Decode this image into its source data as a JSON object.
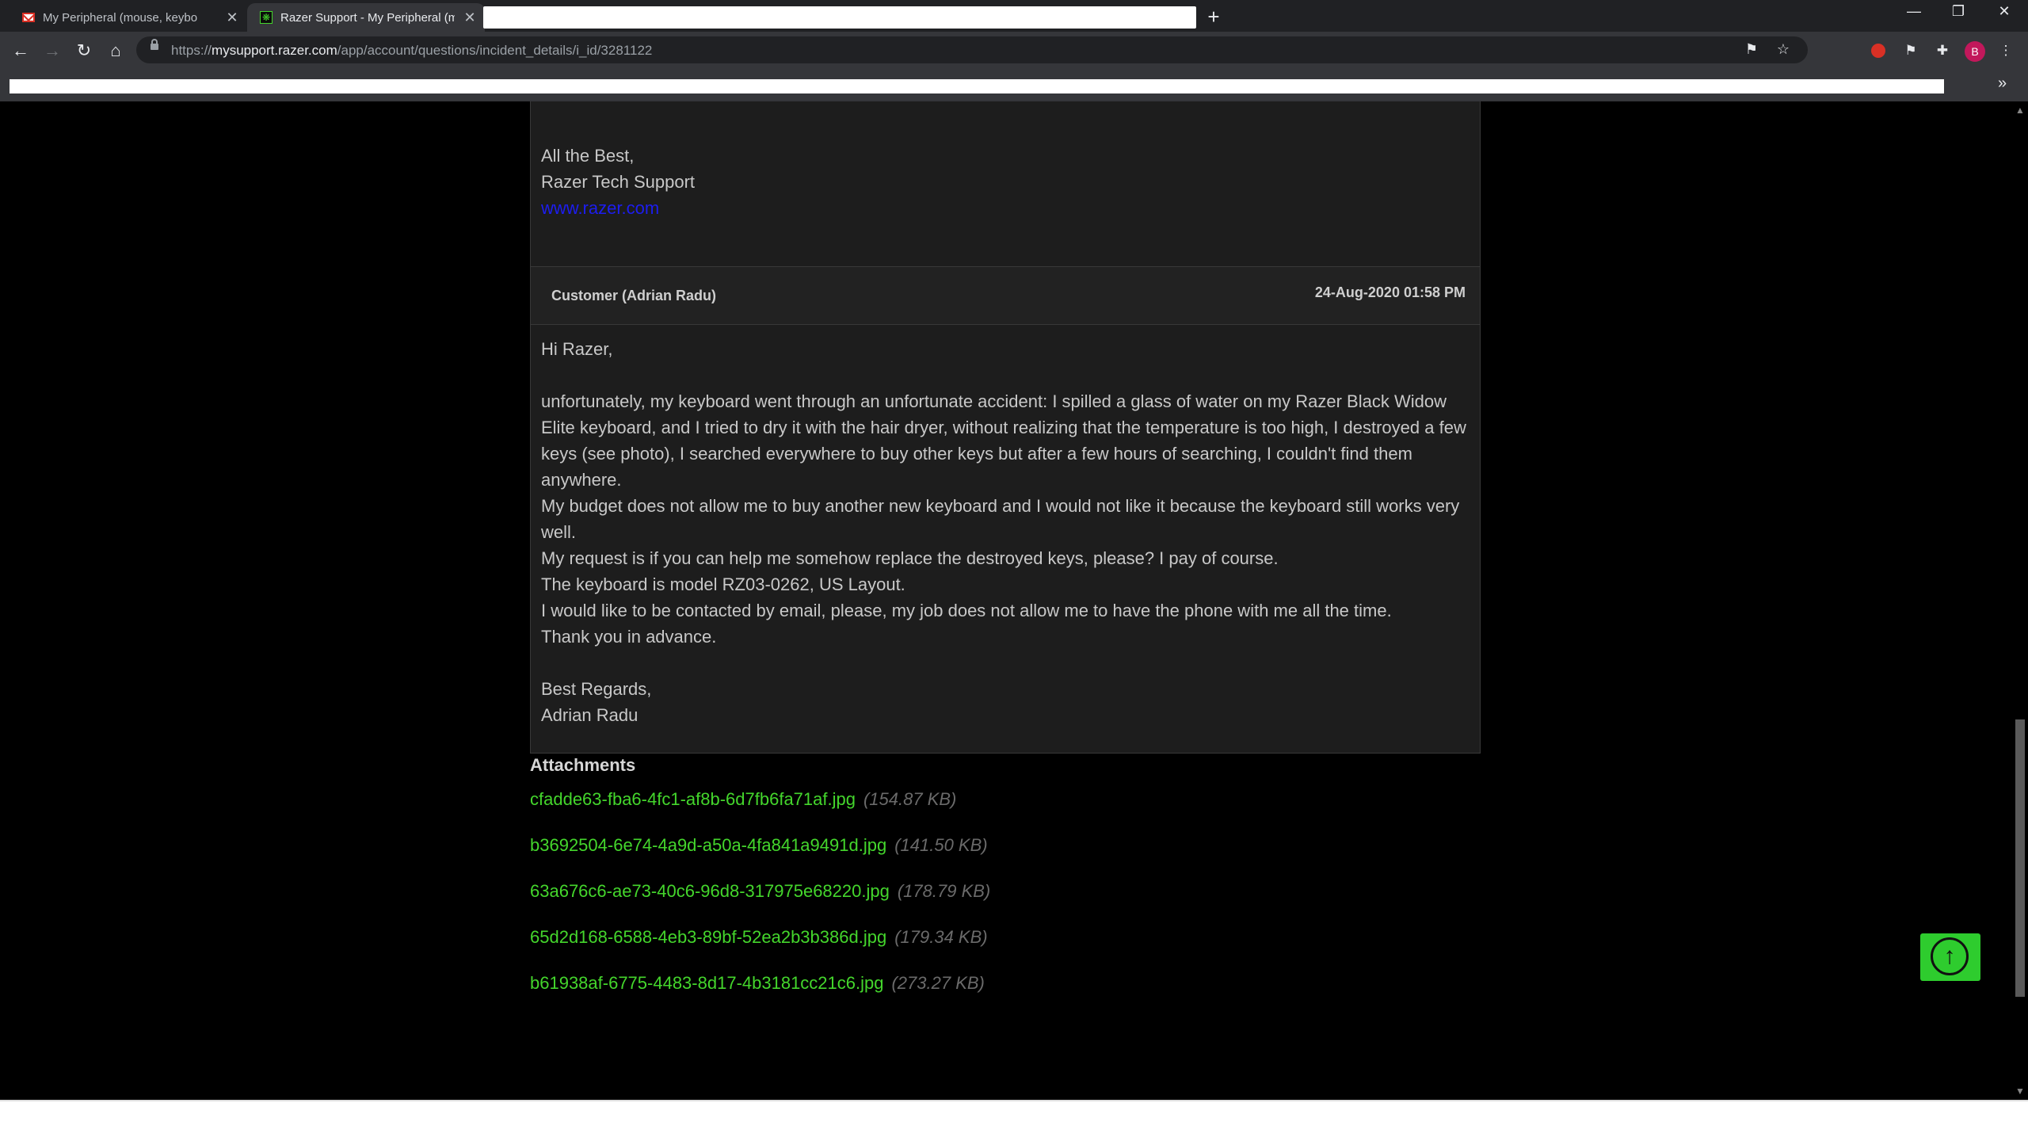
{
  "browser": {
    "tabs": [
      {
        "title": "My Peripheral (mouse, keybo",
        "close": "✕"
      },
      {
        "title": "Razer Support - My Peripheral (m",
        "close": "✕"
      }
    ],
    "new_tab": "+",
    "window": {
      "minimize": "—",
      "restore": "❐",
      "close": "✕"
    },
    "nav": {
      "back": "←",
      "forward": "→",
      "reload": "↻",
      "home": "⌂"
    },
    "url_host": "mysupport.razer.com",
    "url_prefix": "https://",
    "url_path": "/app/account/questions/incident_details/i_id/3281122",
    "profile_initial": "B",
    "bookmarks_more": "»"
  },
  "previous_message": {
    "lines": [
      "All the Best,",
      "Razer Tech Support"
    ],
    "link": "www.razer.com"
  },
  "entry": {
    "author": "Customer (Adrian Radu)",
    "date": "24-Aug-2020 01:58 PM",
    "greeting": "Hi Razer,",
    "paragraph1": "unfortunately, my keyboard went through an unfortunate accident: I spilled a glass of water on my Razer Black Widow Elite keyboard, and I tried to dry it with the hair dryer, without realizing that the temperature is too high, I destroyed a few keys (see photo), I searched everywhere to buy other keys but after a few hours of searching, I couldn't find them anywhere.",
    "paragraph2": "My budget does not allow me to buy another new keyboard and I would not like it because the keyboard still works very well.",
    "line3": "My request is if you can help me somehow replace the destroyed keys, please? I pay of course.",
    "line4": "The keyboard is model RZ03-0262, US Layout.",
    "line5": "I would like to be contacted by email, please, my job does not allow me to have the phone with me all the time.",
    "line6": "Thank you in advance.",
    "signoff": "Best Regards,",
    "signature": "Adrian Radu"
  },
  "attachments": {
    "title": "Attachments",
    "items": [
      {
        "name": "cfadde63-fba6-4fc1-af8b-6d7fb6fa71af.jpg",
        "size": "(154.87 KB)"
      },
      {
        "name": "b3692504-6e74-4a9d-a50a-4fa841a9491d.jpg",
        "size": "(141.50 KB)"
      },
      {
        "name": "63a676c6-ae73-40c6-96d8-317975e68220.jpg",
        "size": "(178.79 KB)"
      },
      {
        "name": "65d2d168-6588-4eb3-89bf-52ea2b3b386d.jpg",
        "size": "(179.34 KB)"
      },
      {
        "name": "b61938af-6775-4483-8d17-4b3181cc21c6.jpg",
        "size": "(273.27 KB)"
      }
    ]
  },
  "colors": {
    "accent_green": "#44d62c",
    "link_blue": "#1d1df0",
    "panel_bg": "#1d1d1d",
    "page_bg": "#000000"
  }
}
